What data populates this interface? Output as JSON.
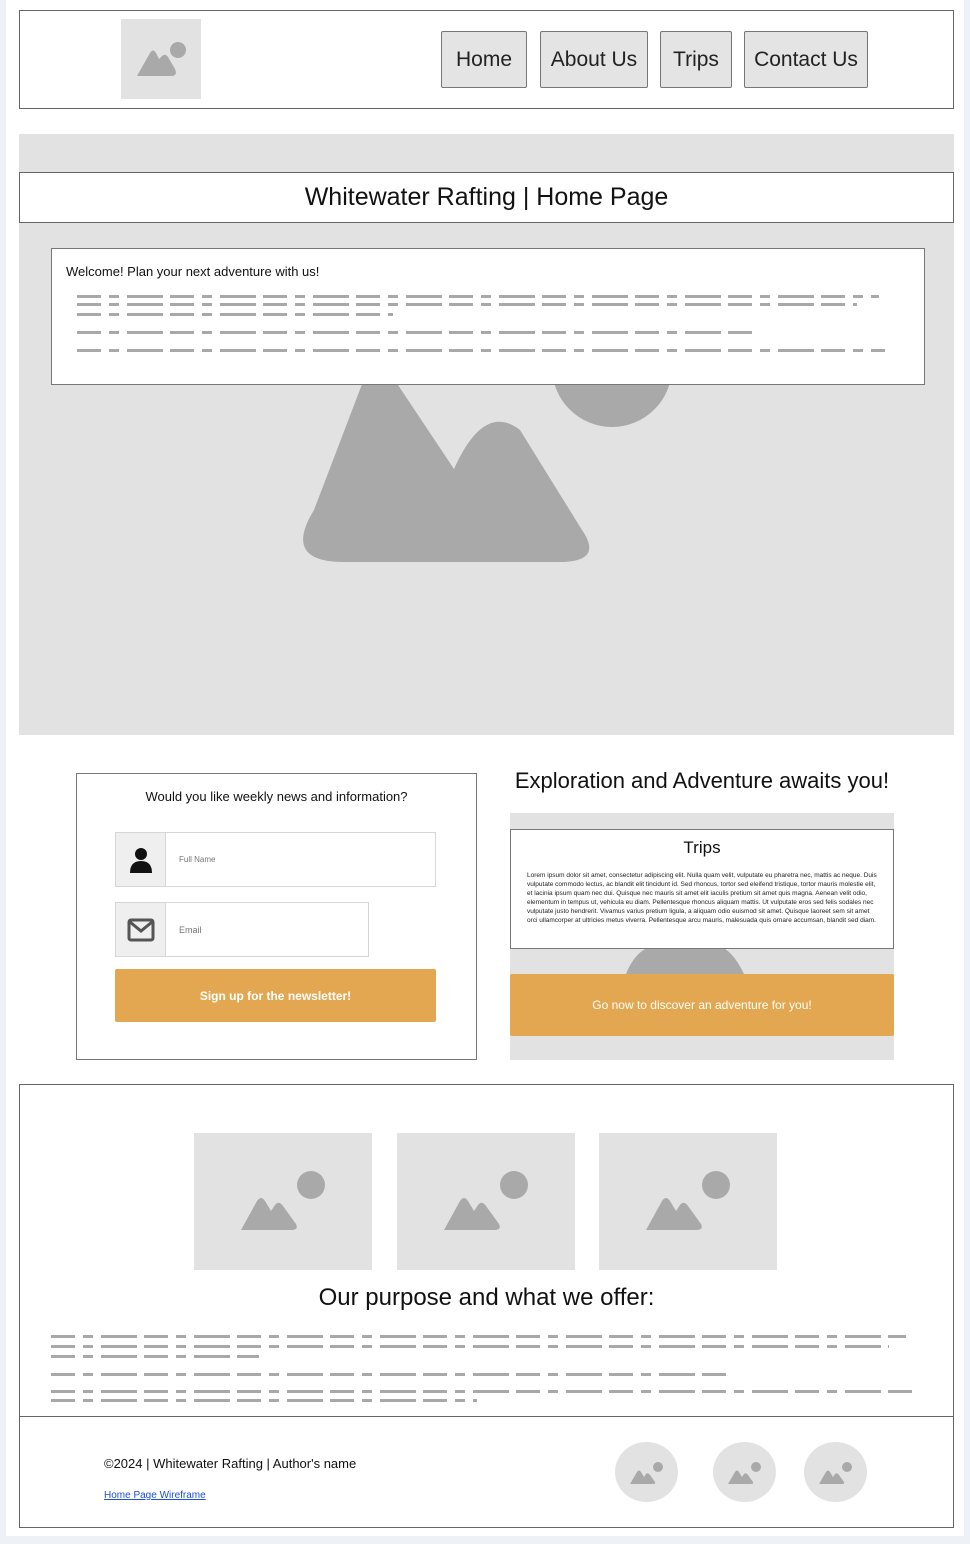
{
  "header": {
    "logo_icon": "image-placeholder-icon",
    "nav": [
      {
        "label": "Home"
      },
      {
        "label": "About Us"
      },
      {
        "label": "Trips"
      },
      {
        "label": "Contact Us"
      }
    ]
  },
  "hero": {
    "title": "Whitewater Rafting | Home Page",
    "welcome_title": "Welcome! Plan your next adventure with us!"
  },
  "newsletter": {
    "question": "Would you like weekly news and information?",
    "name_placeholder": "Full Name",
    "email_placeholder": "Email",
    "button_label": "Sign up for the newsletter!"
  },
  "explore": {
    "title": "Exploration and Adventure awaits you!",
    "card_title": "Trips",
    "card_text": "Lorem ipsum dolor sit amet, consectetur adipiscing elit. Nulla quam velit, vulputate eu pharetra nec, mattis ac neque. Duis vulputate commodo lectus, ac blandit elit tincidunt id. Sed rhoncus, tortor sed eleifend tristique, tortor mauris molestie elit, et lacinia ipsum quam nec dui. Quisque nec mauris sit amet elit iaculis pretium sit amet quis magna. Aenean velit odio, elementum in tempus ut, vehicula eu diam. Pellentesque rhoncus aliquam mattis. Ut vulputate eros sed felis sodales nec vulputate justo hendrerit. Vivamus varius pretium ligula, a aliquam odio euismod sit amet. Quisque laoreet sem sit amet orci ullamcorper at ultricies metus viverra. Pellentesque arcu mauris, malesuada quis ornare accumsan, blandit sed diam.",
    "button_label": "Go now to discover an adventure for you!"
  },
  "purpose": {
    "title": "Our purpose and what we offer:"
  },
  "footer": {
    "copyright": "©2024 | Whitewater Rafting | Author's name",
    "link_label": "Home Page Wireframe"
  },
  "colors": {
    "accent": "#e2a750",
    "placeholder": "#e2e2e2",
    "placeholder_icon": "#a9a9a9",
    "link": "#1a4fd6"
  }
}
